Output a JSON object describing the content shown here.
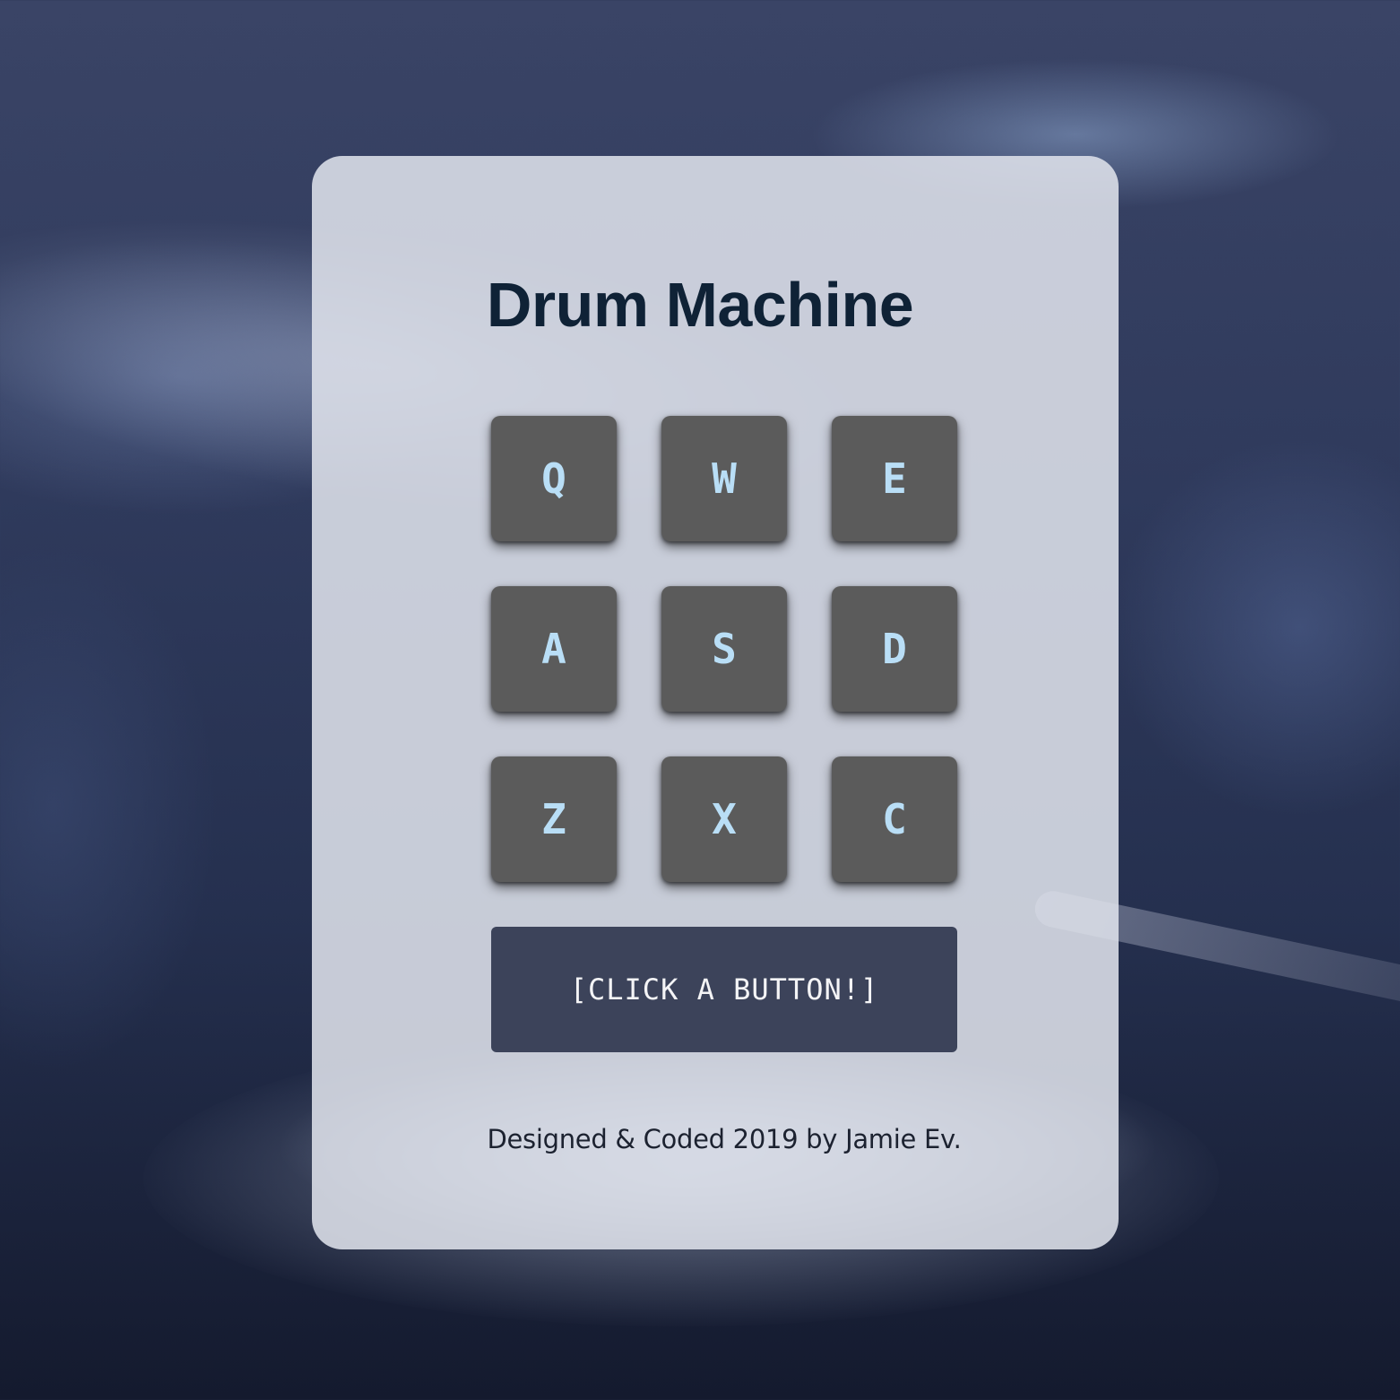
{
  "title": "Drum Machine",
  "pads": [
    {
      "key": "Q"
    },
    {
      "key": "W"
    },
    {
      "key": "E"
    },
    {
      "key": "A"
    },
    {
      "key": "S"
    },
    {
      "key": "D"
    },
    {
      "key": "Z"
    },
    {
      "key": "X"
    },
    {
      "key": "C"
    }
  ],
  "display": {
    "text": "[CLICK A BUTTON!]"
  },
  "footer": {
    "credit": "Designed & Coded 2019 by Jamie Ev."
  },
  "colors": {
    "pad_background": "#5b5b5b",
    "pad_label": "#b9def6",
    "display_background": "#3c435a",
    "title": "#0f2236"
  }
}
